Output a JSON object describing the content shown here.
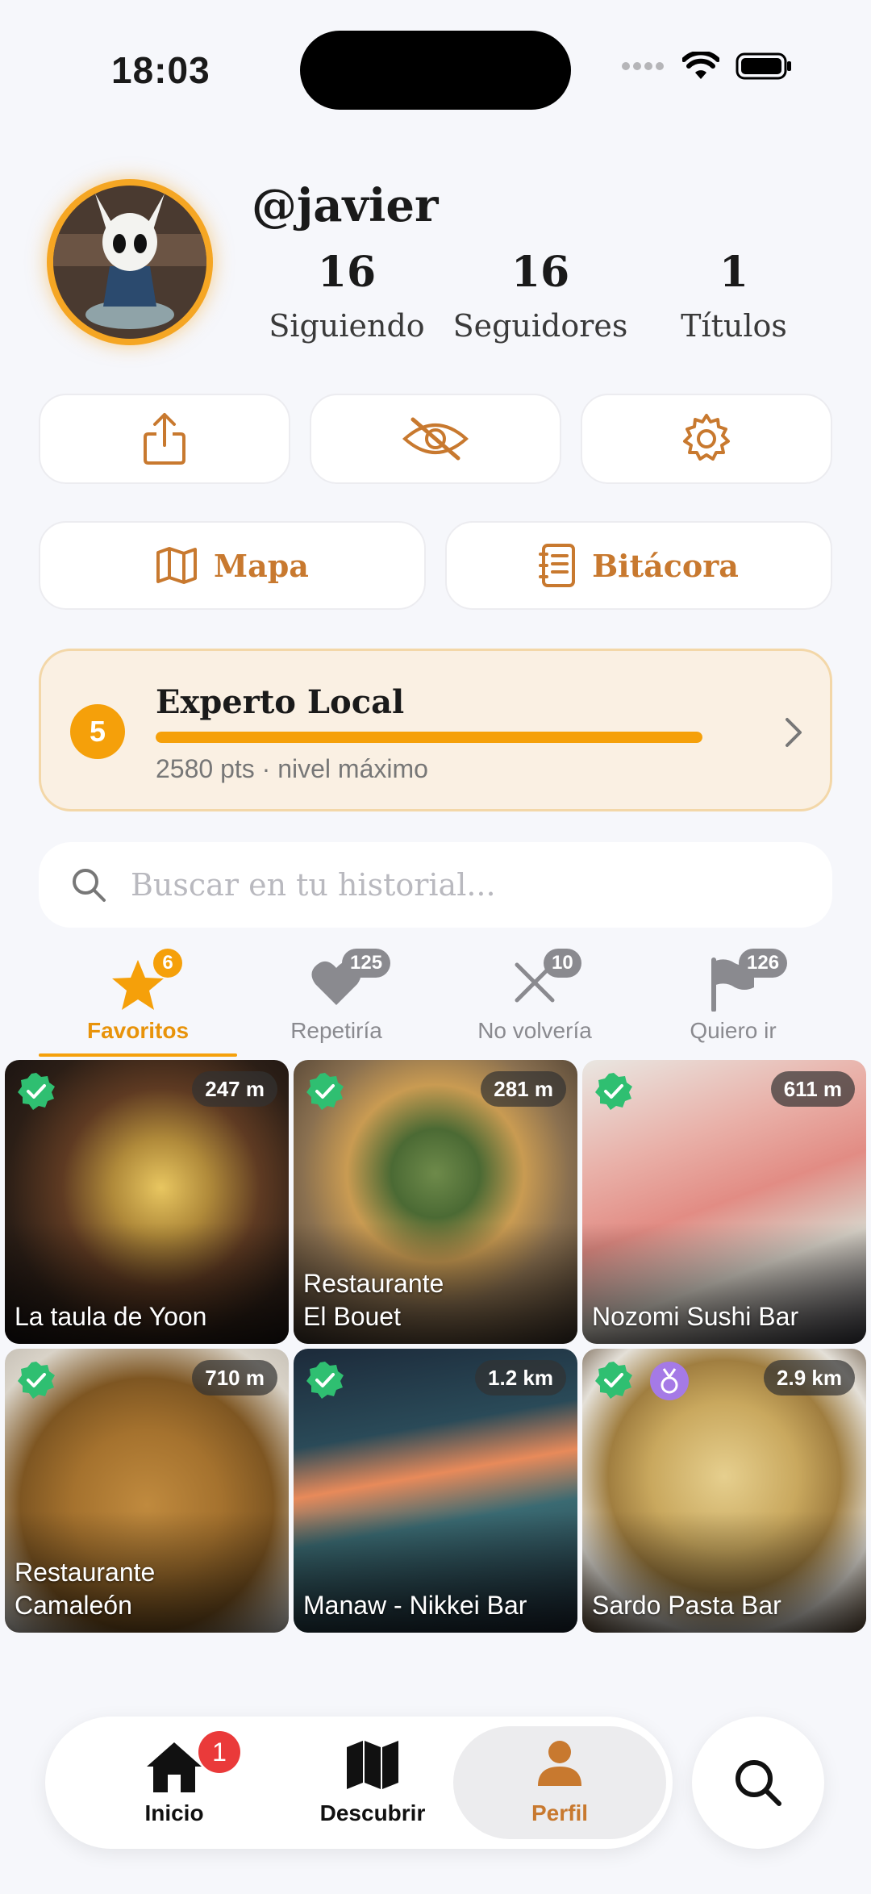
{
  "status": {
    "time": "18:03"
  },
  "profile": {
    "username": "@javier",
    "stats": [
      {
        "value": "16",
        "label": "Siguiendo"
      },
      {
        "value": "16",
        "label": "Seguidores"
      },
      {
        "value": "1",
        "label": "Títulos"
      }
    ]
  },
  "actions": {
    "map_label": "Mapa",
    "log_label": "Bitácora"
  },
  "level": {
    "number": "5",
    "title": "Experto Local",
    "subtitle": "2580 pts · nivel máximo",
    "progress": 1.0
  },
  "search": {
    "placeholder": "Buscar en tu historial..."
  },
  "tabs": [
    {
      "label": "Favoritos",
      "count": "6",
      "icon": "star-icon",
      "active": true
    },
    {
      "label": "Repetiría",
      "count": "125",
      "icon": "heart-icon",
      "active": false
    },
    {
      "label": "No volvería",
      "count": "10",
      "icon": "x-icon",
      "active": false
    },
    {
      "label": "Quiero ir",
      "count": "126",
      "icon": "flag-icon",
      "active": false
    }
  ],
  "restaurants": [
    {
      "name": "La taula de Yoon",
      "distance": "247 m",
      "visited": true
    },
    {
      "name": "Restaurante El Bouet",
      "distance": "281 m",
      "visited": true
    },
    {
      "name": "Nozomi Sushi Bar",
      "distance": "611 m",
      "visited": true
    },
    {
      "name": "Restaurante Camaleón",
      "distance": "710 m",
      "visited": true
    },
    {
      "name": "Manaw - Nikkei Bar",
      "distance": "1.2 km",
      "visited": true
    },
    {
      "name": "Sardo Pasta Bar",
      "distance": "2.9 km",
      "visited": true,
      "medal": true
    }
  ],
  "nav": {
    "items": [
      {
        "label": "Inicio",
        "badge": "1"
      },
      {
        "label": "Descubrir"
      },
      {
        "label": "Perfil",
        "active": true
      }
    ]
  },
  "colors": {
    "accent": "#f5a00a",
    "brand_brown": "#c8792f",
    "check_green": "#2fbf71"
  }
}
